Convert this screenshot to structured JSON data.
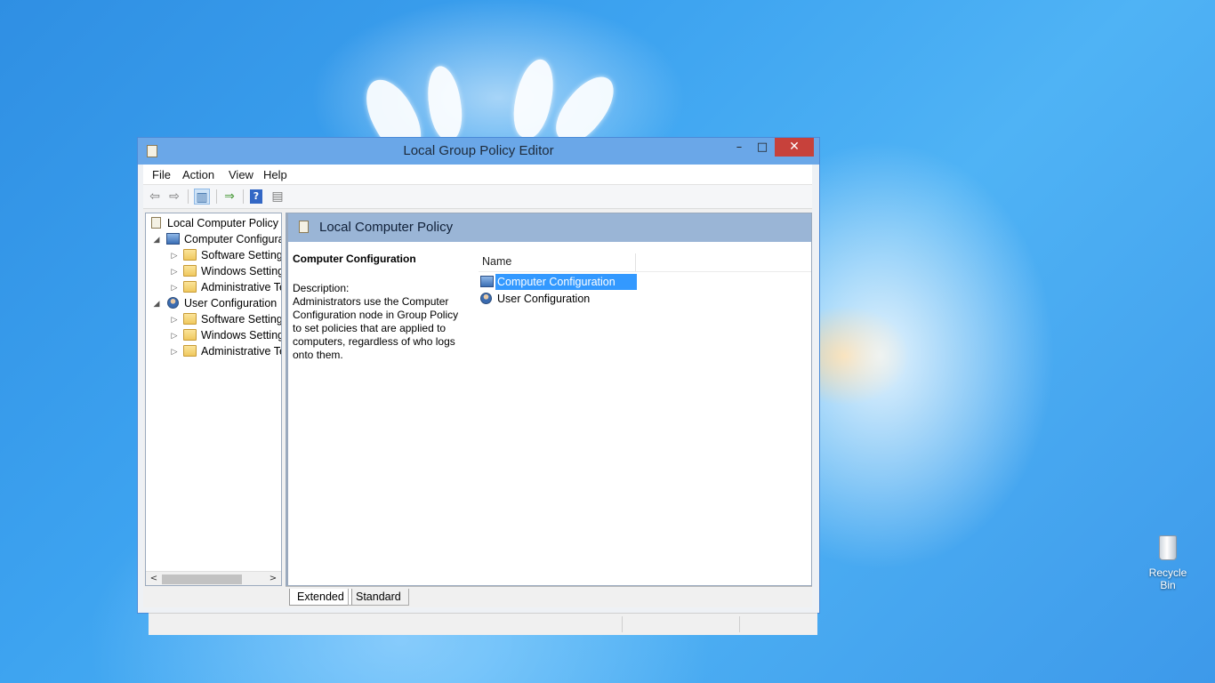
{
  "window": {
    "title": "Local Group Policy Editor",
    "controls": {
      "minimize": "–",
      "maximize": "□",
      "close": "✕"
    }
  },
  "menubar": {
    "items": [
      "File",
      "Action",
      "View",
      "Help"
    ]
  },
  "toolbar": {
    "buttons": [
      {
        "icon": "back-arrow-icon",
        "glyph": "⇦"
      },
      {
        "icon": "forward-arrow-icon",
        "glyph": "⇨"
      },
      {
        "icon": "show-hide-console-tree-icon",
        "glyph": "▥",
        "pressed": true
      },
      {
        "icon": "export-list-icon",
        "glyph": "⇒"
      },
      {
        "icon": "help-icon",
        "glyph": "?"
      },
      {
        "icon": "show-hide-action-pane-icon",
        "glyph": "▤"
      }
    ]
  },
  "tree": {
    "items": [
      {
        "label": "Local Computer Policy",
        "icon": "policy-icon",
        "level": 0,
        "expander": ""
      },
      {
        "label": "Computer Configura",
        "icon": "computer-icon",
        "level": 1,
        "expander": "◢"
      },
      {
        "label": "Software Settings",
        "icon": "folder-icon",
        "level": 2,
        "expander": "▷"
      },
      {
        "label": "Windows Setting",
        "icon": "folder-icon",
        "level": 2,
        "expander": "▷"
      },
      {
        "label": "Administrative Te",
        "icon": "folder-icon",
        "level": 2,
        "expander": "▷"
      },
      {
        "label": "User Configuration",
        "icon": "user-icon",
        "level": 1,
        "expander": "◢"
      },
      {
        "label": "Software Settings",
        "icon": "folder-icon",
        "level": 2,
        "expander": "▷"
      },
      {
        "label": "Windows Setting",
        "icon": "folder-icon",
        "level": 2,
        "expander": "▷"
      },
      {
        "label": "Administrative Te",
        "icon": "folder-icon",
        "level": 2,
        "expander": "▷"
      }
    ],
    "scroll_left": "<",
    "scroll_right": ">"
  },
  "details": {
    "header_title": "Local Computer Policy",
    "description_heading": "Computer Configuration",
    "description_label": "Description:",
    "description_text": "Administrators use the Computer Configuration node in Group Policy to set policies that are applied to computers, regardless of who logs onto them.",
    "column_name": "Name",
    "rows": [
      {
        "label": "Computer Configuration",
        "icon": "computer-icon",
        "selected": true
      },
      {
        "label": "User Configuration",
        "icon": "user-icon",
        "selected": false
      }
    ]
  },
  "tabs": [
    {
      "label": "Extended",
      "active": true
    },
    {
      "label": "Standard",
      "active": false
    }
  ],
  "desktop": {
    "recycle_bin_label": "Recycle Bin"
  },
  "colors": {
    "selection": "#3399ff",
    "close_button": "#c7413b",
    "titlebar": "#6aa7e8",
    "pane_header": "#9ab5d6"
  }
}
